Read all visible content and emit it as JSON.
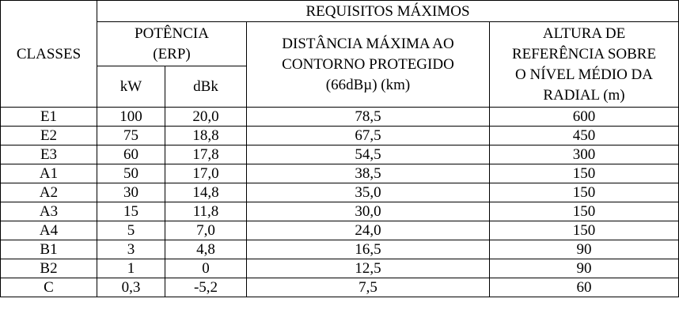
{
  "header": {
    "classes": "CLASSES",
    "requisitos": "REQUISITOS MÁXIMOS",
    "potencia_line1": "POTÊNCIA",
    "potencia_line2": "(ERP)",
    "kw": "kW",
    "dbk": "dBk",
    "distancia_line1": "DISTÂNCIA MÁXIMA AO",
    "distancia_line2": "CONTORNO PROTEGIDO",
    "distancia_line3": "(66dBµ) (km)",
    "altura_line1": "ALTURA DE",
    "altura_line2": "REFERÊNCIA SOBRE",
    "altura_line3": "O NÍVEL MÉDIO DA",
    "altura_line4": "RADIAL (m)"
  },
  "rows": [
    {
      "classe": "E1",
      "kw": "100",
      "dbk": "20,0",
      "distancia": "78,5",
      "altura": "600"
    },
    {
      "classe": "E2",
      "kw": "75",
      "dbk": "18,8",
      "distancia": "67,5",
      "altura": "450"
    },
    {
      "classe": "E3",
      "kw": "60",
      "dbk": "17,8",
      "distancia": "54,5",
      "altura": "300"
    },
    {
      "classe": "A1",
      "kw": "50",
      "dbk": "17,0",
      "distancia": "38,5",
      "altura": "150"
    },
    {
      "classe": "A2",
      "kw": "30",
      "dbk": "14,8",
      "distancia": "35,0",
      "altura": "150"
    },
    {
      "classe": "A3",
      "kw": "15",
      "dbk": "11,8",
      "distancia": "30,0",
      "altura": "150"
    },
    {
      "classe": "A4",
      "kw": "5",
      "dbk": "7,0",
      "distancia": "24,0",
      "altura": "150"
    },
    {
      "classe": "B1",
      "kw": "3",
      "dbk": "4,8",
      "distancia": "16,5",
      "altura": "90"
    },
    {
      "classe": "B2",
      "kw": "1",
      "dbk": "0",
      "distancia": "12,5",
      "altura": "90"
    },
    {
      "classe": "C",
      "kw": "0,3",
      "dbk": "-5,2",
      "distancia": "7,5",
      "altura": "60"
    }
  ]
}
